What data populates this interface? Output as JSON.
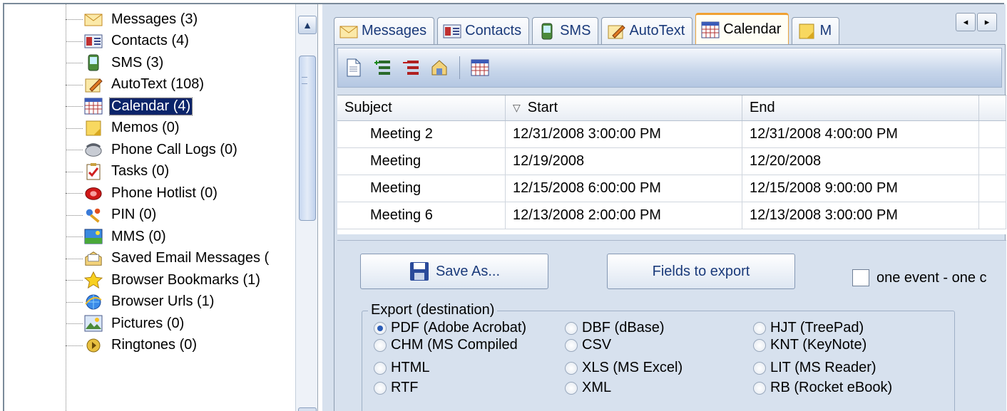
{
  "tree": {
    "items": [
      {
        "label": "Messages (3)",
        "icon": "envelope-icon"
      },
      {
        "label": "Contacts (4)",
        "icon": "contact-card-icon"
      },
      {
        "label": "SMS (3)",
        "icon": "phone-icon"
      },
      {
        "label": "AutoText (108)",
        "icon": "pencil-note-icon"
      },
      {
        "label": "Calendar (4)",
        "icon": "calendar-icon",
        "selected": true
      },
      {
        "label": "Memos (0)",
        "icon": "memo-icon"
      },
      {
        "label": "Phone Call Logs (0)",
        "icon": "telephone-icon"
      },
      {
        "label": "Tasks (0)",
        "icon": "checklist-icon"
      },
      {
        "label": "Phone Hotlist (0)",
        "icon": "hotlist-phone-icon"
      },
      {
        "label": "PIN (0)",
        "icon": "pin-icon"
      },
      {
        "label": "MMS (0)",
        "icon": "mms-icon"
      },
      {
        "label": "Saved Email Messages (",
        "icon": "saved-email-icon"
      },
      {
        "label": "Browser Bookmarks (1)",
        "icon": "star-icon"
      },
      {
        "label": "Browser Urls (1)",
        "icon": "browser-icon"
      },
      {
        "label": "Pictures (0)",
        "icon": "picture-icon"
      },
      {
        "label": "Ringtones (0)",
        "icon": "ringtone-icon"
      }
    ]
  },
  "tabs": [
    {
      "label": "Messages",
      "icon": "envelope-icon"
    },
    {
      "label": "Contacts",
      "icon": "contact-card-icon"
    },
    {
      "label": "SMS",
      "icon": "phone-icon"
    },
    {
      "label": "AutoText",
      "icon": "pencil-note-icon"
    },
    {
      "label": "Calendar",
      "icon": "calendar-icon",
      "active": true
    },
    {
      "label": "M",
      "icon": "memo-icon"
    }
  ],
  "tab_scroll": {
    "left": "◂",
    "right": "▸"
  },
  "grid": {
    "columns": [
      "Subject",
      "Start",
      "End"
    ],
    "sort_indicator": "▽",
    "rows": [
      [
        "Meeting 2",
        "12/31/2008 3:00:00 PM",
        "12/31/2008 4:00:00 PM"
      ],
      [
        "Meeting",
        "12/19/2008",
        "12/20/2008"
      ],
      [
        "Meeting",
        "12/15/2008 6:00:00 PM",
        "12/15/2008 9:00:00 PM"
      ],
      [
        "Meeting 6",
        "12/13/2008 2:00:00 PM",
        "12/13/2008 3:00:00 PM"
      ]
    ]
  },
  "export": {
    "save_as_label": "Save As...",
    "fields_label": "Fields to export",
    "one_event_label": "one event - one c",
    "group_title": "Export (destination)",
    "options": [
      {
        "label": "PDF (Adobe Acrobat)",
        "checked": true
      },
      {
        "label": "DBF (dBase)"
      },
      {
        "label": "HJT (TreePad)"
      },
      {
        "label": "CHM (MS Compiled"
      },
      {
        "label": "CSV"
      },
      {
        "label": "KNT (KeyNote)"
      },
      {
        "label": "HTML"
      },
      {
        "label": "XLS (MS Excel)"
      },
      {
        "label": "LIT (MS Reader)"
      },
      {
        "label": "RTF"
      },
      {
        "label": "XML"
      },
      {
        "label": "RB (Rocket eBook)"
      }
    ]
  }
}
